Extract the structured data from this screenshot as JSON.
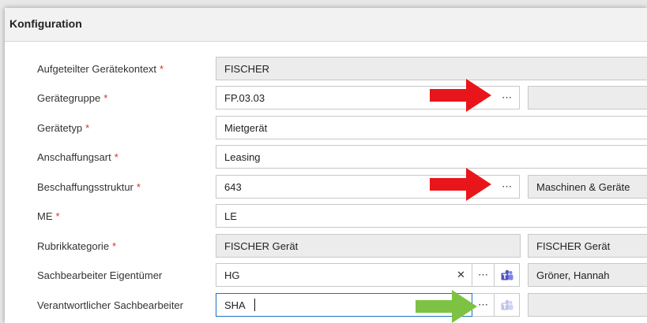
{
  "section": {
    "title": "Konfiguration"
  },
  "required_marker": "*",
  "colors": {
    "accent": "#1a73c6",
    "required": "#d0342c",
    "annotation_red": "#e8161a",
    "annotation_green": "#7dc242"
  },
  "icons": {
    "more": "⋯",
    "clear": "✕",
    "teams": "teams-icon"
  },
  "fields": {
    "context": {
      "label": "Aufgeteilter Gerätekontext",
      "value": "FISCHER"
    },
    "group": {
      "label": "Gerätegruppe",
      "value": "FP.03.03",
      "side_value": ""
    },
    "type": {
      "label": "Gerätetyp",
      "value": "Mietgerät"
    },
    "acquisition": {
      "label": "Anschaffungsart",
      "value": "Leasing"
    },
    "procurement": {
      "label": "Beschaffungsstruktur",
      "value": "643",
      "side_value": "Maschinen & Geräte"
    },
    "me": {
      "label": "ME",
      "value": "LE"
    },
    "category": {
      "label": "Rubrikkategorie",
      "value": "FISCHER Gerät",
      "side_value": "FISCHER Gerät"
    },
    "owner": {
      "label": "Sachbearbeiter Eigentümer",
      "value": "HG",
      "side_value": "Gröner, Hannah"
    },
    "responsible": {
      "label": "Verantwortlicher Sachbearbeiter",
      "value": "SHA",
      "side_value": ""
    }
  }
}
